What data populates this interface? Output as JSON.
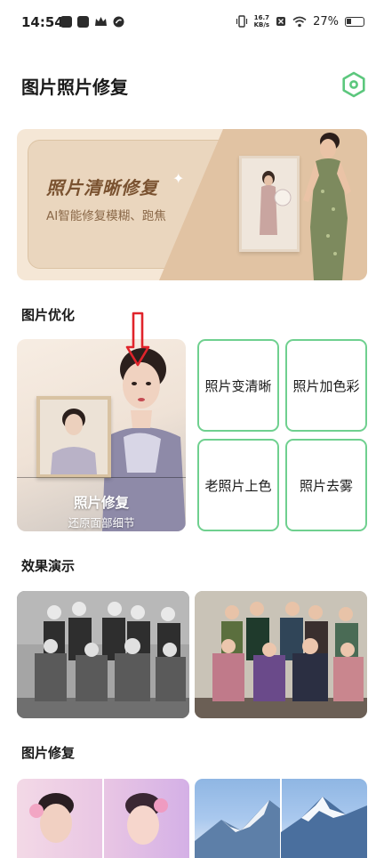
{
  "status_bar": {
    "time": "14:54",
    "net_speed_value": "16.7",
    "net_speed_unit": "KB/s",
    "battery": "27%"
  },
  "header": {
    "title": "图片照片修复",
    "settings_icon": "hexagon-settings-icon",
    "accent_color": "#5cc77d"
  },
  "banner": {
    "title": "照片清晰修复",
    "subtitle": "AI智能修复模糊、跑焦"
  },
  "sections": {
    "optimize": "图片优化",
    "demo": "效果演示",
    "repair": "图片修复"
  },
  "features": {
    "photo_repair": {
      "name": "照片修复",
      "desc": "还原面部细节"
    },
    "enhance": "照片变清晰",
    "colorize": "照片加色彩",
    "old_photo_color": "老照片上色",
    "dehaze": "照片去雾"
  }
}
